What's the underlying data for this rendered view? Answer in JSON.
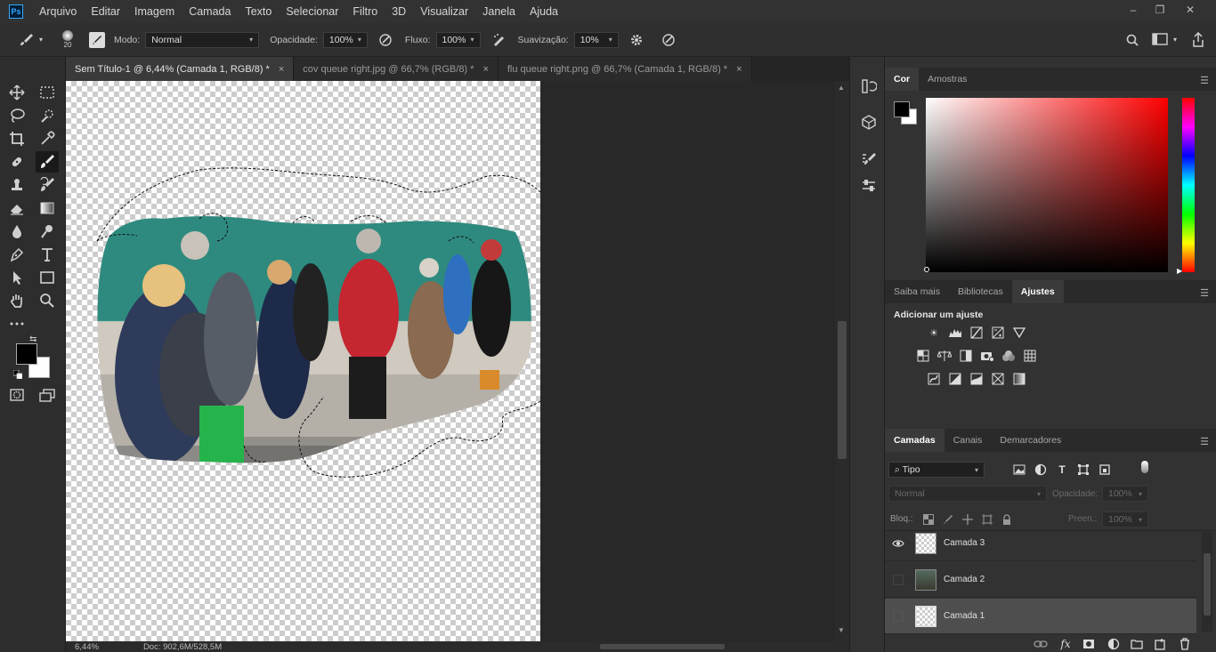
{
  "menubar": {
    "logo": "Ps",
    "items": [
      "Arquivo",
      "Editar",
      "Imagem",
      "Camada",
      "Texto",
      "Selecionar",
      "Filtro",
      "3D",
      "Visualizar",
      "Janela",
      "Ajuda"
    ],
    "window_controls": [
      "–",
      "❐",
      "✕"
    ]
  },
  "options": {
    "brush_size": "20",
    "mode_label": "Modo:",
    "mode_value": "Normal",
    "opacity_label": "Opacidade:",
    "opacity_value": "100%",
    "flow_label": "Fluxo:",
    "flow_value": "100%",
    "smoothing_label": "Suavização:",
    "smoothing_value": "10%"
  },
  "tabs": [
    {
      "label": "Sem Título-1 @ 6,44% (Camada 1, RGB/8) *",
      "close": "×"
    },
    {
      "label": "cov queue right.jpg @ 66,7% (RGB/8) *",
      "close": "×"
    },
    {
      "label": "flu queue right.png @ 66,7% (Camada 1, RGB/8) *",
      "close": "×"
    }
  ],
  "status": {
    "zoom": "6,44%",
    "doc": "Doc: 902,6M/528,5M"
  },
  "color_panel": {
    "tabs": [
      "Cor",
      "Amostras"
    ],
    "foreground": "#000000",
    "background": "#ffffff",
    "hue_color": "#ff0000"
  },
  "adjust_panel": {
    "tabs": [
      "Saiba mais",
      "Bibliotecas",
      "Ajustes"
    ],
    "title": "Adicionar um ajuste"
  },
  "layers_panel": {
    "tabs": [
      "Camadas",
      "Canais",
      "Demarcadores"
    ],
    "filter_value": "Tipo",
    "blend_value": "Normal",
    "opacity_label": "Opacidade:",
    "opacity_value": "100%",
    "lock_label": "Bloq.:",
    "fill_label": "Preen.:",
    "fill_value": "100%",
    "layers": [
      {
        "name": "Camada 3",
        "visible": true
      },
      {
        "name": "Camada 2",
        "visible": false
      },
      {
        "name": "Camada 1",
        "visible": false,
        "selected": true
      }
    ]
  }
}
